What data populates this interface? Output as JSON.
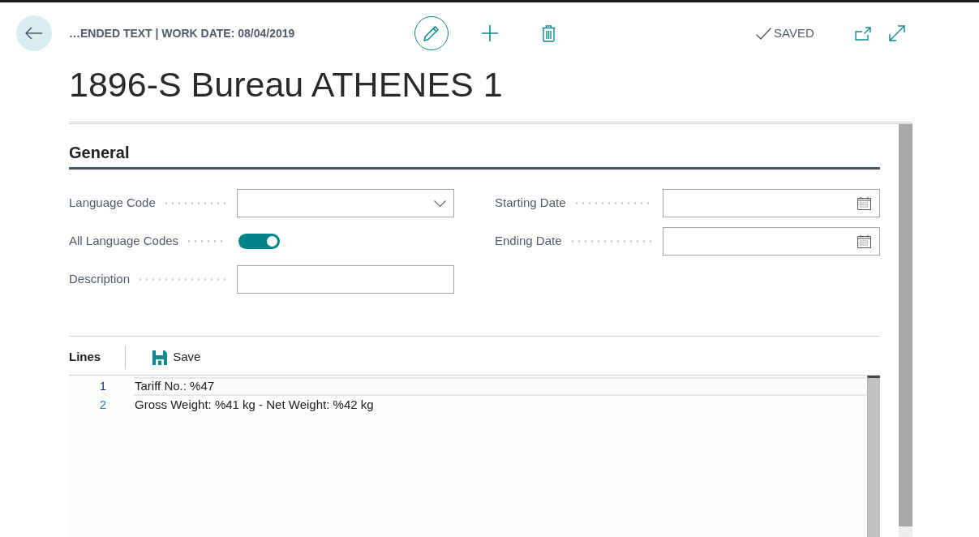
{
  "header": {
    "breadcrumb": "…ENDED TEXT | WORK DATE: 08/04/2019",
    "status": "SAVED"
  },
  "title": "1896-S Bureau ATHENES 1",
  "general": {
    "heading": "General",
    "columns": [
      {
        "fields": [
          {
            "kind": "dropdown",
            "label": "Language Code"
          },
          {
            "kind": "toggle",
            "label": "All Language Codes",
            "on": true
          },
          {
            "kind": "text",
            "label": "Description"
          }
        ]
      },
      {
        "fields": [
          {
            "kind": "date",
            "label": "Starting Date"
          },
          {
            "kind": "date",
            "label": "Ending Date"
          }
        ]
      }
    ]
  },
  "lines": {
    "heading": "Lines",
    "actions": [
      {
        "label": "Save"
      }
    ],
    "rows": [
      {
        "number": "1",
        "text": "Tariff No.: %47",
        "selected": true
      },
      {
        "number": "2",
        "text": "Gross Weight: %41 kg - Net Weight: %42 kg",
        "selected": false
      }
    ]
  }
}
